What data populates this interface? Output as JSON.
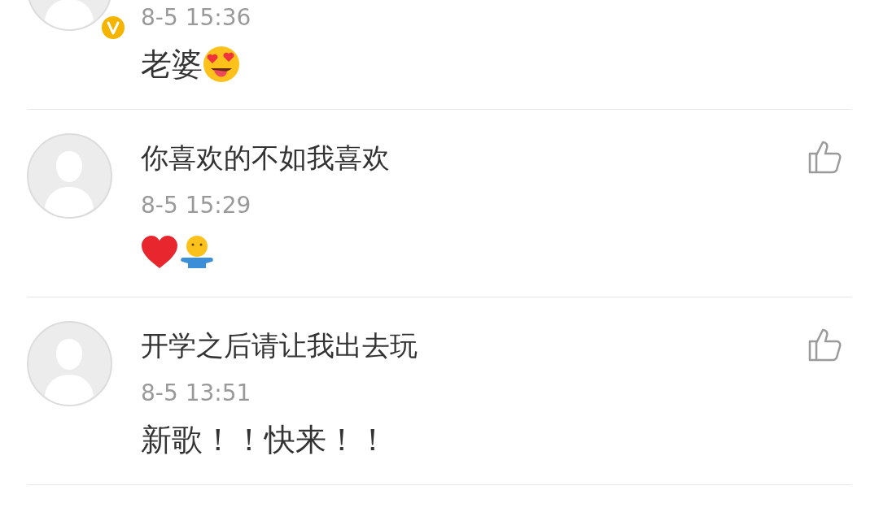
{
  "comments": [
    {
      "verified": true,
      "time": "8-5 15:36",
      "content": [
        {
          "kind": "text",
          "text": "老婆"
        },
        {
          "kind": "heart_eyes_emoji"
        }
      ]
    },
    {
      "name": "你喜欢的不如我喜欢",
      "verified": false,
      "time": "8-5 15:29",
      "content": [
        {
          "kind": "heart_emoji"
        },
        {
          "kind": "hug_emoji"
        }
      ]
    },
    {
      "name": "开学之后请让我出去玩",
      "verified": false,
      "time": "8-5 13:51",
      "content": [
        {
          "kind": "text",
          "text": "新歌！！快来！！"
        }
      ]
    }
  ]
}
